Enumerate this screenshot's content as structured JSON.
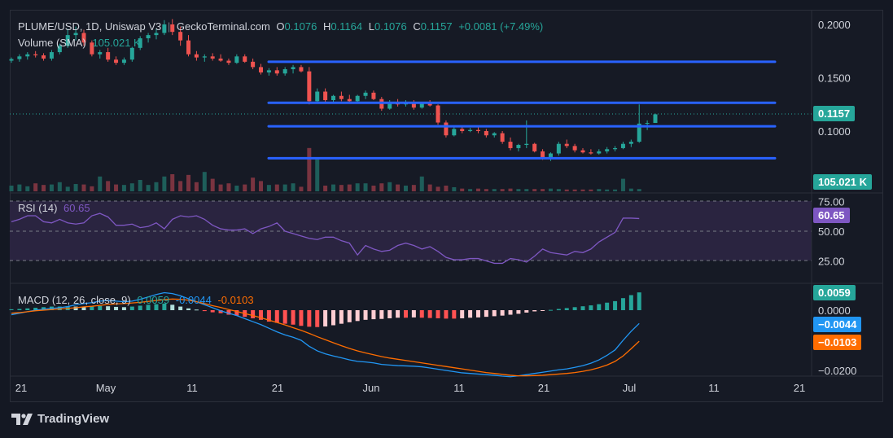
{
  "header": {
    "symbol": "PLUME/USD, 1D, Uniswap V3",
    "separator": "|",
    "source": "GeckoTerminal.com",
    "o_label": "O",
    "o_val": "0.1076",
    "h_label": "H",
    "h_val": "0.1164",
    "l_label": "L",
    "l_val": "0.1076",
    "c_label": "C",
    "c_val": "0.1157",
    "change": "+0.0081 (+7.49%)",
    "volume_label": "Volume (SMA)",
    "volume_val": "105.021 K"
  },
  "rsi": {
    "label": "RSI (14)",
    "value": "60.65"
  },
  "macd": {
    "label": "MACD (12, 26, close, 9)",
    "hist": "0.0059",
    "macd": "-0.0044",
    "signal": "-0.0103"
  },
  "tags": {
    "price": "0.1157",
    "volume": "105.021 K",
    "rsi": "60.65",
    "macd_hist": "0.0059",
    "macd_line": "−0.0044",
    "macd_signal": "−0.0103"
  },
  "footer": {
    "brand": "TradingView"
  },
  "colors": {
    "up": "#26a69a",
    "down": "#ef5350",
    "level": "#2962ff",
    "rsi": "#7e57c2",
    "macd": "#2196f3",
    "signal": "#ff6d00"
  },
  "chart_data": {
    "type": "candlestick",
    "x_ticks": [
      "21",
      "May",
      "11",
      "21",
      "Jun",
      "11",
      "21",
      "Jul",
      "11",
      "21"
    ],
    "price_ticks": [
      "0.2000",
      "0.1500",
      "0.1000"
    ],
    "rsi_ticks": [
      "75.00",
      "50.00",
      "25.00"
    ],
    "macd_ticks": [
      "0.0000",
      "−0.0200"
    ],
    "price_range": [
      0.072,
      0.2
    ],
    "ohlc": [
      [
        0.166,
        0.169,
        0.164,
        0.1675
      ],
      [
        0.1675,
        0.172,
        0.165,
        0.17
      ],
      [
        0.17,
        0.174,
        0.167,
        0.172
      ],
      [
        0.172,
        0.175,
        0.169,
        0.171
      ],
      [
        0.171,
        0.173,
        0.166,
        0.168
      ],
      [
        0.168,
        0.176,
        0.166,
        0.174
      ],
      [
        0.174,
        0.182,
        0.172,
        0.18
      ],
      [
        0.18,
        0.196,
        0.178,
        0.19
      ],
      [
        0.19,
        0.198,
        0.185,
        0.192
      ],
      [
        0.192,
        0.195,
        0.18,
        0.183
      ],
      [
        0.183,
        0.185,
        0.17,
        0.172
      ],
      [
        0.172,
        0.176,
        0.168,
        0.174
      ],
      [
        0.174,
        0.178,
        0.165,
        0.167
      ],
      [
        0.167,
        0.17,
        0.162,
        0.164
      ],
      [
        0.164,
        0.169,
        0.162,
        0.167
      ],
      [
        0.167,
        0.179,
        0.165,
        0.178
      ],
      [
        0.178,
        0.189,
        0.176,
        0.187
      ],
      [
        0.187,
        0.192,
        0.183,
        0.19
      ],
      [
        0.19,
        0.196,
        0.186,
        0.192
      ],
      [
        0.192,
        0.204,
        0.19,
        0.2
      ],
      [
        0.2,
        0.205,
        0.19,
        0.193
      ],
      [
        0.193,
        0.198,
        0.18,
        0.185
      ],
      [
        0.185,
        0.19,
        0.17,
        0.172
      ],
      [
        0.172,
        0.175,
        0.166,
        0.169
      ],
      [
        0.169,
        0.172,
        0.165,
        0.17
      ],
      [
        0.17,
        0.173,
        0.166,
        0.168
      ],
      [
        0.168,
        0.172,
        0.165,
        0.166
      ],
      [
        0.166,
        0.168,
        0.162,
        0.164
      ],
      [
        0.164,
        0.172,
        0.163,
        0.17
      ],
      [
        0.17,
        0.172,
        0.164,
        0.165
      ],
      [
        0.165,
        0.168,
        0.158,
        0.16
      ],
      [
        0.16,
        0.163,
        0.153,
        0.155
      ],
      [
        0.155,
        0.159,
        0.152,
        0.157
      ],
      [
        0.157,
        0.16,
        0.152,
        0.154
      ],
      [
        0.154,
        0.16,
        0.152,
        0.158
      ],
      [
        0.158,
        0.162,
        0.154,
        0.16
      ],
      [
        0.16,
        0.162,
        0.155,
        0.156
      ],
      [
        0.156,
        0.16,
        0.125,
        0.128
      ],
      [
        0.128,
        0.14,
        0.126,
        0.137
      ],
      [
        0.137,
        0.14,
        0.127,
        0.129
      ],
      [
        0.129,
        0.134,
        0.127,
        0.133
      ],
      [
        0.133,
        0.137,
        0.128,
        0.13
      ],
      [
        0.13,
        0.134,
        0.126,
        0.128
      ],
      [
        0.128,
        0.134,
        0.127,
        0.133
      ],
      [
        0.133,
        0.138,
        0.13,
        0.136
      ],
      [
        0.136,
        0.138,
        0.129,
        0.13
      ],
      [
        0.13,
        0.132,
        0.119,
        0.121
      ],
      [
        0.121,
        0.129,
        0.12,
        0.127
      ],
      [
        0.127,
        0.13,
        0.123,
        0.125
      ],
      [
        0.125,
        0.129,
        0.123,
        0.127
      ],
      [
        0.127,
        0.129,
        0.12,
        0.122
      ],
      [
        0.122,
        0.127,
        0.121,
        0.126
      ],
      [
        0.126,
        0.129,
        0.123,
        0.124
      ],
      [
        0.124,
        0.125,
        0.106,
        0.108
      ],
      [
        0.108,
        0.11,
        0.094,
        0.096
      ],
      [
        0.096,
        0.104,
        0.095,
        0.102
      ],
      [
        0.102,
        0.104,
        0.098,
        0.1
      ],
      [
        0.1,
        0.103,
        0.099,
        0.101
      ],
      [
        0.101,
        0.104,
        0.098,
        0.1
      ],
      [
        0.1,
        0.102,
        0.094,
        0.096
      ],
      [
        0.096,
        0.099,
        0.094,
        0.098
      ],
      [
        0.098,
        0.1,
        0.088,
        0.09
      ],
      [
        0.09,
        0.094,
        0.082,
        0.084
      ],
      [
        0.084,
        0.088,
        0.081,
        0.087
      ],
      [
        0.087,
        0.11,
        0.084,
        0.088
      ],
      [
        0.088,
        0.089,
        0.08,
        0.081
      ],
      [
        0.081,
        0.083,
        0.073,
        0.075
      ],
      [
        0.075,
        0.08,
        0.072,
        0.079
      ],
      [
        0.079,
        0.09,
        0.077,
        0.088
      ],
      [
        0.088,
        0.092,
        0.084,
        0.086
      ],
      [
        0.086,
        0.088,
        0.08,
        0.082
      ],
      [
        0.082,
        0.084,
        0.079,
        0.08
      ],
      [
        0.08,
        0.083,
        0.078,
        0.079
      ],
      [
        0.079,
        0.083,
        0.078,
        0.081
      ],
      [
        0.081,
        0.085,
        0.079,
        0.083
      ],
      [
        0.083,
        0.086,
        0.081,
        0.084
      ],
      [
        0.084,
        0.09,
        0.083,
        0.088
      ],
      [
        0.088,
        0.092,
        0.085,
        0.09
      ],
      [
        0.09,
        0.125,
        0.089,
        0.107
      ],
      [
        0.107,
        0.11,
        0.101,
        0.1076
      ],
      [
        0.1076,
        0.1164,
        0.1076,
        0.1157
      ]
    ],
    "volume": [
      0.25,
      0.3,
      0.22,
      0.35,
      0.28,
      0.3,
      0.4,
      0.2,
      0.32,
      0.3,
      0.22,
      0.65,
      0.45,
      0.3,
      0.28,
      0.35,
      0.5,
      0.28,
      0.4,
      0.65,
      0.75,
      0.45,
      0.72,
      0.4,
      0.85,
      0.55,
      0.3,
      0.35,
      0.25,
      0.3,
      0.6,
      0.45,
      0.28,
      0.3,
      0.3,
      0.35,
      0.2,
      1.9,
      1.4,
      0.25,
      0.3,
      0.28,
      0.3,
      0.35,
      0.35,
      0.25,
      0.35,
      0.4,
      0.3,
      0.25,
      0.28,
      0.65,
      0.3,
      0.2,
      0.25,
      0.18,
      0.12,
      0.1,
      0.12,
      0.1,
      0.1,
      0.1,
      0.12,
      0.1,
      0.1,
      0.1,
      0.1,
      0.12,
      0.1,
      0.08,
      0.08,
      0.08,
      0.08,
      0.1,
      0.08,
      0.08,
      0.55,
      0.12,
      0.1
    ],
    "rsi": [
      58,
      60,
      63,
      63,
      58,
      57,
      60,
      57,
      56,
      57,
      63,
      65,
      62,
      55,
      55,
      56,
      53,
      54,
      57,
      52,
      60,
      63,
      62,
      63,
      60,
      55,
      52,
      51,
      51,
      52,
      48,
      52,
      54,
      57,
      50,
      48,
      46,
      44,
      43,
      45,
      45,
      42,
      40,
      30,
      38,
      35,
      33,
      34,
      38,
      40,
      38,
      35,
      37,
      33,
      28,
      26,
      26,
      27,
      27,
      25,
      23,
      23,
      27,
      26,
      24,
      29,
      35,
      32,
      31,
      30,
      33,
      32,
      35,
      41,
      45,
      49,
      61,
      61,
      60.65
    ],
    "macd_hist": [
      0.0003,
      0.0004,
      0.0006,
      0.0008,
      0.001,
      0.0012,
      0.0012,
      0.0013,
      0.0012,
      0.0011,
      0.0012,
      0.0014,
      0.0013,
      0.0011,
      0.001,
      0.0012,
      0.0015,
      0.0018,
      0.002,
      0.0022,
      0.0018,
      0.0012,
      0.0006,
      0.0002,
      -0.0003,
      -0.0007,
      -0.001,
      -0.0015,
      -0.0018,
      -0.0022,
      -0.0027,
      -0.0032,
      -0.0038,
      -0.0042,
      -0.0045,
      -0.0048,
      -0.0052,
      -0.0055,
      -0.0056,
      -0.0054,
      -0.005,
      -0.0045,
      -0.004,
      -0.0036,
      -0.0032,
      -0.003,
      -0.0029,
      -0.0027,
      -0.0025,
      -0.0025,
      -0.0024,
      -0.0025,
      -0.0026,
      -0.0027,
      -0.0028,
      -0.0028,
      -0.0027,
      -0.0025,
      -0.0024,
      -0.0022,
      -0.002,
      -0.0018,
      -0.0015,
      -0.0012,
      -0.0008,
      -0.0004,
      -0.0002,
      0.0001,
      0.0004,
      0.0007,
      0.001,
      0.0013,
      0.0016,
      0.002,
      0.0025,
      0.003,
      0.004,
      0.005,
      0.0059
    ],
    "macd_line": [
      -0.0015,
      -0.001,
      -0.0005,
      0.0,
      0.0003,
      0.0006,
      0.0008,
      0.0012,
      0.0018,
      0.0022,
      0.0025,
      0.003,
      0.0032,
      0.003,
      0.0028,
      0.003,
      0.0036,
      0.0044,
      0.0052,
      0.0058,
      0.0055,
      0.0048,
      0.0038,
      0.0028,
      0.0018,
      0.0008,
      -0.0002,
      -0.001,
      -0.0018,
      -0.0028,
      -0.0038,
      -0.0048,
      -0.006,
      -0.0072,
      -0.0082,
      -0.009,
      -0.01,
      -0.012,
      -0.0135,
      -0.0145,
      -0.0152,
      -0.0158,
      -0.0165,
      -0.017,
      -0.0172,
      -0.0175,
      -0.018,
      -0.0182,
      -0.0184,
      -0.0185,
      -0.0186,
      -0.0188,
      -0.0192,
      -0.0196,
      -0.02,
      -0.0204,
      -0.0208,
      -0.021,
      -0.0212,
      -0.0214,
      -0.0216,
      -0.0219,
      -0.0221,
      -0.0218,
      -0.0214,
      -0.021,
      -0.0206,
      -0.0202,
      -0.0198,
      -0.0195,
      -0.019,
      -0.0184,
      -0.0176,
      -0.0165,
      -0.015,
      -0.0132,
      -0.01,
      -0.007,
      -0.0044
    ],
    "signal_line": [
      -0.001,
      -0.0008,
      -0.0005,
      -0.0002,
      0.0,
      0.0002,
      0.0004,
      0.0006,
      0.0008,
      0.0011,
      0.0013,
      0.0016,
      0.0019,
      0.0021,
      0.0022,
      0.0024,
      0.0026,
      0.0029,
      0.0032,
      0.0035,
      0.0037,
      0.0036,
      0.0033,
      0.0028,
      0.0022,
      0.0015,
      0.0009,
      0.0002,
      -0.0004,
      -0.0011,
      -0.0018,
      -0.0025,
      -0.0033,
      -0.0041,
      -0.0049,
      -0.0058,
      -0.0067,
      -0.0077,
      -0.0088,
      -0.0098,
      -0.0108,
      -0.0118,
      -0.0127,
      -0.0135,
      -0.0142,
      -0.0148,
      -0.0154,
      -0.0159,
      -0.0163,
      -0.0167,
      -0.0171,
      -0.0175,
      -0.0179,
      -0.0183,
      -0.0187,
      -0.0191,
      -0.0195,
      -0.0199,
      -0.0203,
      -0.0207,
      -0.021,
      -0.0213,
      -0.0216,
      -0.0218,
      -0.0218,
      -0.0217,
      -0.0216,
      -0.0214,
      -0.0212,
      -0.021,
      -0.0207,
      -0.0203,
      -0.0198,
      -0.0191,
      -0.0182,
      -0.017,
      -0.0152,
      -0.0128,
      -0.0103
    ],
    "levels": [
      0.165,
      0.1265,
      0.1045,
      0.0745
    ]
  }
}
